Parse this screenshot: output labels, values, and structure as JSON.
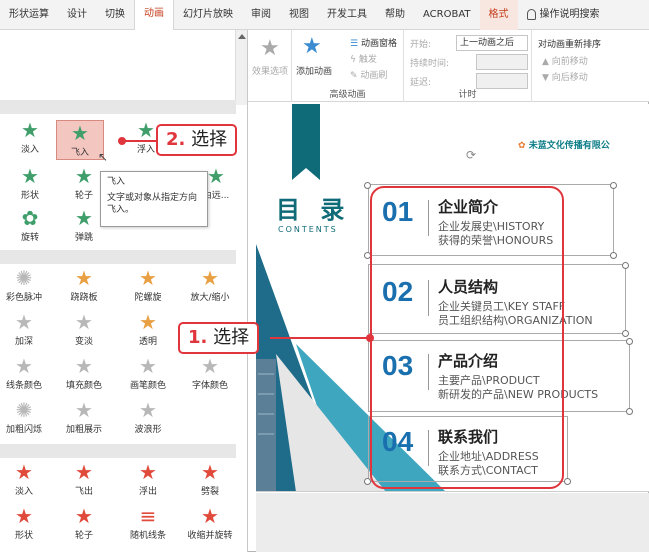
{
  "tabs": [
    {
      "label": "形状运算",
      "active": false
    },
    {
      "label": "设计",
      "active": false
    },
    {
      "label": "切换",
      "active": false
    },
    {
      "label": "动画",
      "active": true
    },
    {
      "label": "幻灯片放映",
      "active": false
    },
    {
      "label": "审阅",
      "active": false
    },
    {
      "label": "视图",
      "active": false
    },
    {
      "label": "开发工具",
      "active": false
    },
    {
      "label": "帮助",
      "active": false
    },
    {
      "label": "ACROBAT",
      "active": false
    },
    {
      "label": "格式",
      "active": false
    }
  ],
  "help_search": "操作说明搜索",
  "ribbon": {
    "effect_options": "效果选项",
    "add_animation": "添加动画",
    "animation_pane": "动画窗格",
    "trigger": "触发",
    "animation_painter": "动画刷",
    "advanced_group": "高级动画",
    "start_label": "开始:",
    "start_value": "上一动画之后",
    "duration_label": "持续时间:",
    "delay_label": "延迟:",
    "reorder_title": "对动画重新排序",
    "move_earlier": "向前移动",
    "move_later": "向后移动",
    "timing_group": "计时"
  },
  "gallery": {
    "row1": [
      "淡入",
      "飞入",
      "浮入"
    ],
    "row2": [
      "形状",
      "轮子"
    ],
    "row3": [
      "旋转",
      "弹跳"
    ],
    "emphasis_row1": [
      "彩色脉冲",
      "跷跷板",
      "陀螺旋",
      "放大/缩小"
    ],
    "emphasis_row2": [
      "加深",
      "变淡",
      "透明",
      "对象颜色"
    ],
    "emphasis_row3": [
      "线条颜色",
      "填充颜色",
      "画笔颜色",
      "字体颜色"
    ],
    "emphasis_row4": [
      "加粗闪烁",
      "加粗展示",
      "波浪形"
    ],
    "exit_row1": [
      "淡入",
      "飞出",
      "浮出",
      "劈裂"
    ],
    "exit_row2": [
      "形状",
      "轮子",
      "随机线条",
      "收缩并旋转"
    ],
    "partial_label": "由远..."
  },
  "tooltip": {
    "title": "飞入",
    "body": "文字或对象从指定方向飞入。"
  },
  "slide": {
    "title": "目 录",
    "subtitle": "CONTENTS",
    "company": "未蓝文化传播有限公",
    "items": [
      {
        "num": "01",
        "head": "企业简介",
        "line1": "企业发展史\\HISTORY",
        "line2": "获得的荣誉\\HONOURS"
      },
      {
        "num": "02",
        "head": "人员结构",
        "line1": "企业关键员工\\KEY STAFF",
        "line2": "员工组织结构\\ORGANIZATION"
      },
      {
        "num": "03",
        "head": "产品介绍",
        "line1": "主要产品\\PRODUCT",
        "line2": "新研发的产品\\NEW PRODUCTS"
      },
      {
        "num": "04",
        "head": "联系我们",
        "line1": "企业地址\\ADDRESS",
        "line2": "联系方式\\CONTACT"
      }
    ]
  },
  "callouts": {
    "step1_num": "1.",
    "step1_text": "选择",
    "step2_num": "2.",
    "step2_text": "选择"
  },
  "colors": {
    "accent": "#c43e1c",
    "teal": "#0f6b78",
    "number_blue": "#1a6fae",
    "annotation_red": "#e0353c"
  }
}
